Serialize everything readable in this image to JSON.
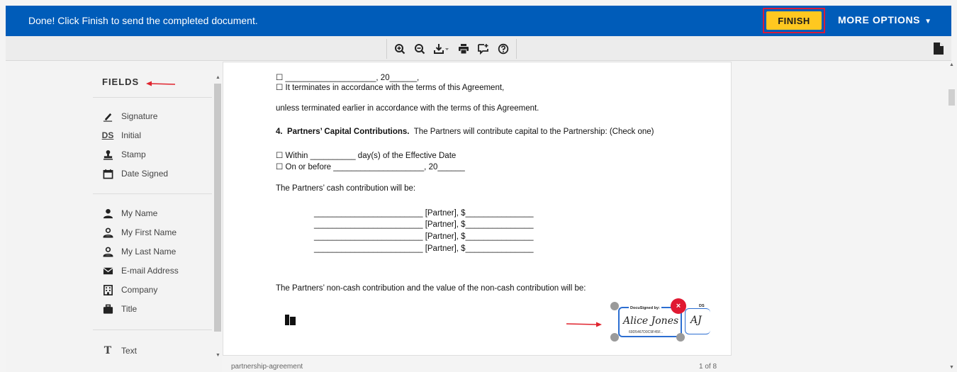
{
  "banner": {
    "message": "Done! Click Finish to send the completed document.",
    "finish_label": "FINISH",
    "more_options_label": "MORE OPTIONS",
    "more_options_caret": "▼"
  },
  "toolbar": {
    "buttons": [
      "zoom-in-icon",
      "zoom-out-icon",
      "download-icon",
      "print-icon",
      "comment-icon",
      "help-icon"
    ],
    "right_icon": "document-icon"
  },
  "fields_panel": {
    "title": "FIELDS",
    "group1": [
      {
        "label": "Signature",
        "icon": "pen-icon"
      },
      {
        "label": "Initial",
        "icon": "initial-ds-icon",
        "icon_text": "DS"
      },
      {
        "label": "Stamp",
        "icon": "stamp-icon"
      },
      {
        "label": "Date Signed",
        "icon": "calendar-icon"
      }
    ],
    "group2": [
      {
        "label": "My Name",
        "icon": "person-icon"
      },
      {
        "label": "My First Name",
        "icon": "person-outline-icon"
      },
      {
        "label": "My Last Name",
        "icon": "person-outline-icon"
      },
      {
        "label": "E-mail Address",
        "icon": "envelope-icon"
      },
      {
        "label": "Company",
        "icon": "building-icon"
      },
      {
        "label": "Title",
        "icon": "briefcase-icon"
      }
    ],
    "group3": [
      {
        "label": "Text",
        "icon": "text-t-icon",
        "icon_text": "T"
      }
    ]
  },
  "document": {
    "lines": {
      "l1": "☐ ____________________, 20______,",
      "l2": "☐ It terminates in accordance with the terms of this Agreement,",
      "l3": "unless terminated earlier in accordance with the terms of this Agreement.",
      "l4_bold": "4.  Partners’ Capital Contributions.",
      "l4_rest": "  The Partners will contribute capital to the Partnership: (Check one)",
      "l5": "☐ Within __________ day(s) of the Effective Date",
      "l6": "☐ On or before ____________________, 20______",
      "l7": "The Partners’ cash contribution will be:",
      "p1": "________________________ [Partner], $_______________",
      "p2": "________________________ [Partner], $_______________",
      "p3": "________________________ [Partner], $_______________",
      "p4": "________________________ [Partner], $_______________",
      "l8": "The Partners’ non-cash contribution and the value of the non-cash contribution will be:"
    },
    "signature": {
      "label": "DocuSigned by:",
      "name": "Alice Jones",
      "hash": "69D5467D0C9F45F...",
      "delete": "×"
    },
    "initial": {
      "label": "DS",
      "text": "AJ"
    }
  },
  "footer": {
    "filename": "partnership-agreement",
    "page": "1 of 8"
  },
  "colors": {
    "banner_bg": "#005cb9",
    "finish_bg": "#ffc820",
    "annotation_red": "#d81b3a",
    "signature_blue": "#2c6ed1"
  }
}
